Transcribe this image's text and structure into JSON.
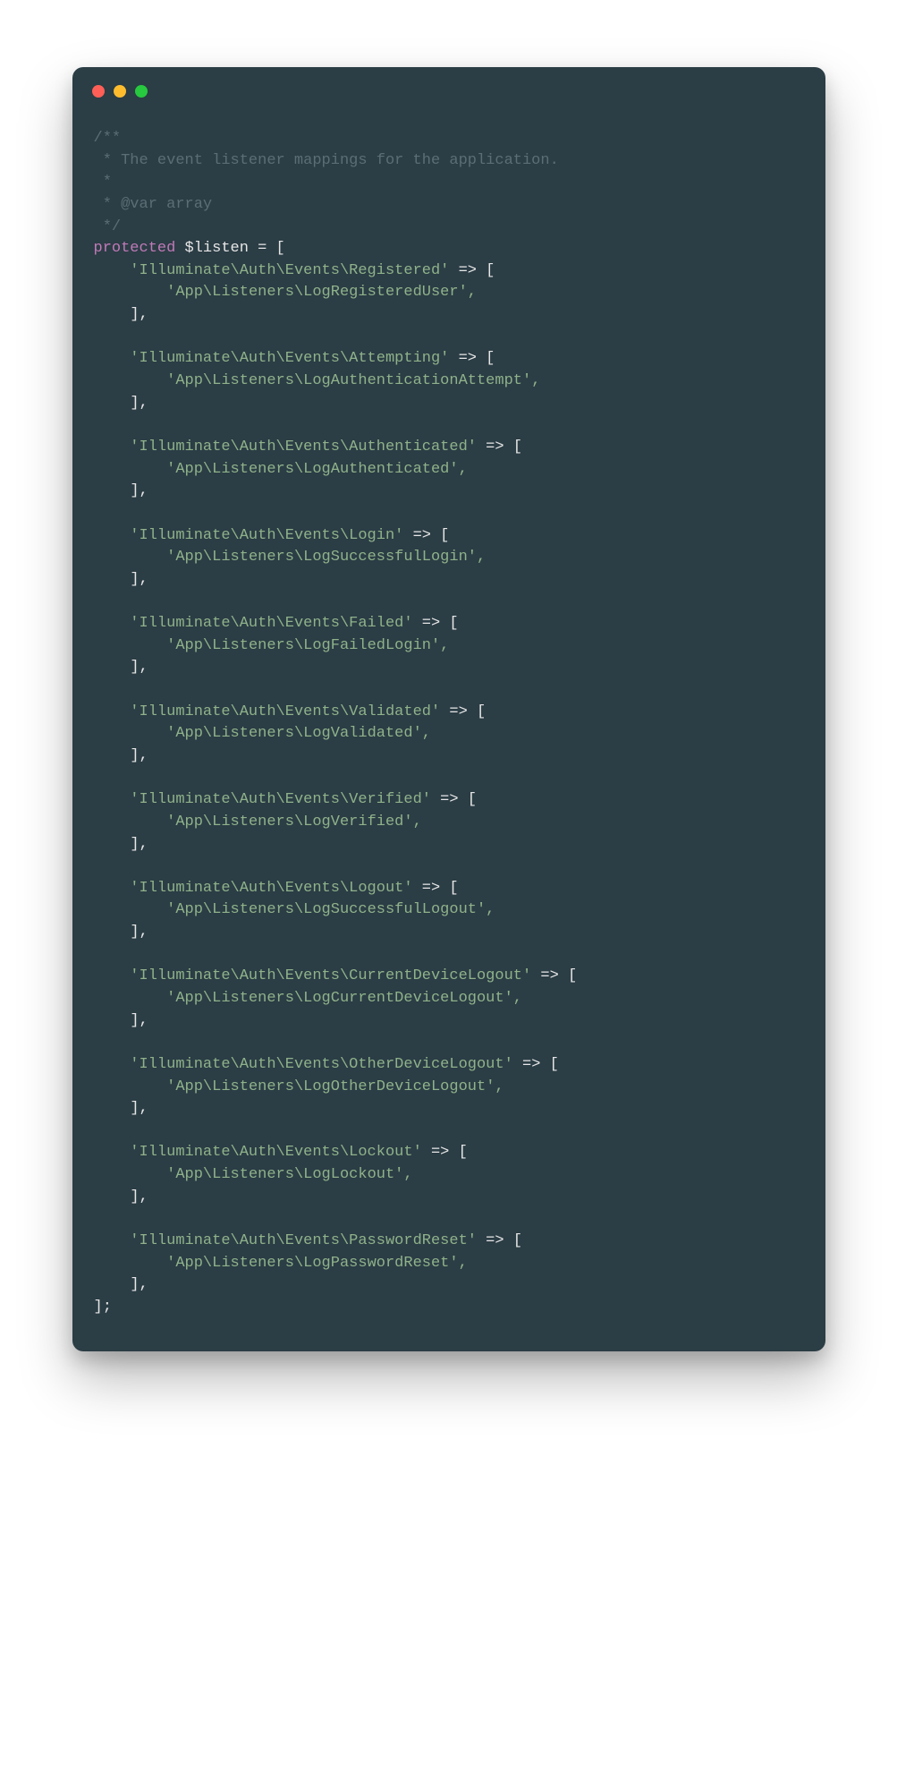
{
  "comment": {
    "open": "/**",
    "line1": " * The event listener mappings for the application.",
    "line2": " *",
    "line3": " * @var array",
    "close": " */"
  },
  "decl": {
    "keyword": "protected",
    "var": "$listen",
    "equals": " = [",
    "close": "];"
  },
  "sym": {
    "string_end_arrow": "' => [",
    "string_end_comma": "',",
    "block_close": "],",
    "indent1_q": "    '",
    "indent2_q": "        '"
  },
  "events": [
    {
      "event": "Illuminate\\Auth\\Events\\Registered",
      "listener": "App\\Listeners\\LogRegisteredUser"
    },
    {
      "event": "Illuminate\\Auth\\Events\\Attempting",
      "listener": "App\\Listeners\\LogAuthenticationAttempt"
    },
    {
      "event": "Illuminate\\Auth\\Events\\Authenticated",
      "listener": "App\\Listeners\\LogAuthenticated"
    },
    {
      "event": "Illuminate\\Auth\\Events\\Login",
      "listener": "App\\Listeners\\LogSuccessfulLogin"
    },
    {
      "event": "Illuminate\\Auth\\Events\\Failed",
      "listener": "App\\Listeners\\LogFailedLogin"
    },
    {
      "event": "Illuminate\\Auth\\Events\\Validated",
      "listener": "App\\Listeners\\LogValidated"
    },
    {
      "event": "Illuminate\\Auth\\Events\\Verified",
      "listener": "App\\Listeners\\LogVerified"
    },
    {
      "event": "Illuminate\\Auth\\Events\\Logout",
      "listener": "App\\Listeners\\LogSuccessfulLogout"
    },
    {
      "event": "Illuminate\\Auth\\Events\\CurrentDeviceLogout",
      "listener": "App\\Listeners\\LogCurrentDeviceLogout"
    },
    {
      "event": "Illuminate\\Auth\\Events\\OtherDeviceLogout",
      "listener": "App\\Listeners\\LogOtherDeviceLogout"
    },
    {
      "event": "Illuminate\\Auth\\Events\\Lockout",
      "listener": "App\\Listeners\\LogLockout"
    },
    {
      "event": "Illuminate\\Auth\\Events\\PasswordReset",
      "listener": "App\\Listeners\\LogPasswordReset"
    }
  ]
}
